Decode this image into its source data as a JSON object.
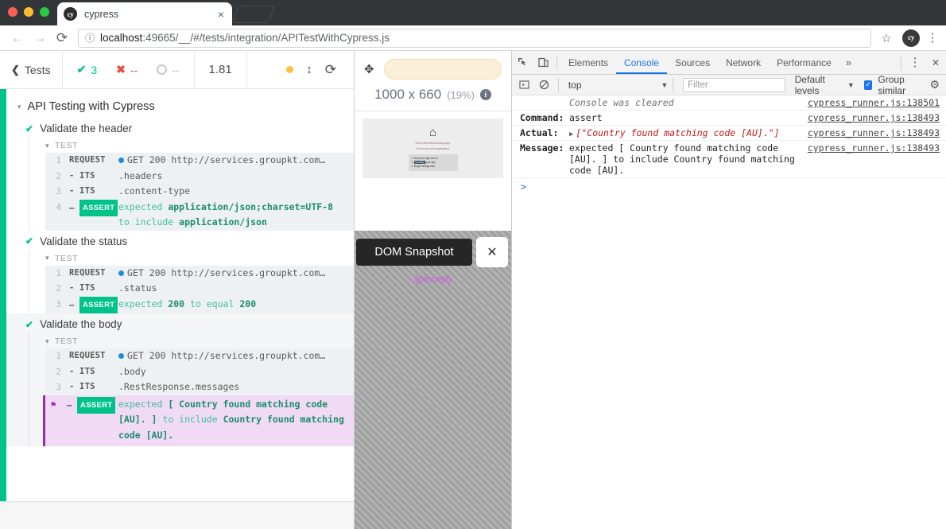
{
  "browser": {
    "tab": {
      "title": "cypress",
      "favicon_text": "cy",
      "close_icon": "×"
    },
    "nav": {
      "back": "←",
      "forward": "→",
      "reload": "⟳"
    },
    "omnibox": {
      "info_icon": "ⓘ",
      "host": "localhost",
      "rest": ":49665/__/#/tests/integration/APITestWithCypress.js",
      "full_url": "localhost:49665/__/#/tests/integration/APITestWithCypress.js"
    },
    "star_icon": "☆",
    "extension_text": "cy",
    "menu_icon": "⋮"
  },
  "reporter": {
    "header": {
      "back_label": "Tests",
      "back_chevron": "❮",
      "passed": {
        "icon": "✔",
        "value": "3"
      },
      "failed": {
        "icon": "✖",
        "value": "--"
      },
      "pending": {
        "value": "--"
      },
      "duration": "1.81",
      "reload_icon": "⟳",
      "updown_icon": "↕"
    },
    "suite": {
      "title": "API Testing with Cypress",
      "triangle": "▾"
    },
    "tests": [
      {
        "name": "Validate the header",
        "check": "✔",
        "group_label": "TEST",
        "commands": [
          {
            "num": "1",
            "name": "REQUEST",
            "message": "GET 200 http://services.groupkt.com…",
            "type": "request"
          },
          {
            "num": "2",
            "name": "- ITS",
            "message": ".headers",
            "type": "plain"
          },
          {
            "num": "3",
            "name": "- ITS",
            "message": ".content-type",
            "type": "plain"
          },
          {
            "num": "4",
            "name": "- ASSERT",
            "message": "expected application/json;charset=UTF-8 to include application/json",
            "type": "assert",
            "parts": [
              {
                "t": "expected ",
                "b": false
              },
              {
                "t": "application/json;charset=UTF-8",
                "b": true
              },
              {
                "t": " to include ",
                "b": false
              },
              {
                "t": "application/json",
                "b": true
              }
            ]
          }
        ]
      },
      {
        "name": "Validate the status",
        "check": "✔",
        "group_label": "TEST",
        "commands": [
          {
            "num": "1",
            "name": "REQUEST",
            "message": "GET 200 http://services.groupkt.com…",
            "type": "request"
          },
          {
            "num": "2",
            "name": "- ITS",
            "message": ".status",
            "type": "plain"
          },
          {
            "num": "3",
            "name": "- ASSERT",
            "message": "expected 200 to equal 200",
            "type": "assert",
            "parts": [
              {
                "t": "expected ",
                "b": false
              },
              {
                "t": "200",
                "b": true
              },
              {
                "t": " to equal ",
                "b": false
              },
              {
                "t": "200",
                "b": true
              }
            ]
          }
        ]
      },
      {
        "name": "Validate the body",
        "check": "✔",
        "group_label": "TEST",
        "commands": [
          {
            "num": "1",
            "name": "REQUEST",
            "message": "GET 200 http://services.groupkt.com…",
            "type": "request"
          },
          {
            "num": "2",
            "name": "- ITS",
            "message": ".body",
            "type": "plain"
          },
          {
            "num": "3",
            "name": "- ITS",
            "message": ".RestResponse.messages",
            "type": "plain"
          },
          {
            "num": "",
            "name": "- ASSERT",
            "pin_icon": "⚑",
            "type": "assert-pinned",
            "message": "expected [ Country found matching code [AU]. ] to include Country found matching code [AU].",
            "parts": [
              {
                "t": "expected ",
                "b": false
              },
              {
                "t": "[ Country found matching code [AU]. ]",
                "b": true
              },
              {
                "t": " to include ",
                "b": false
              },
              {
                "t": "Country found matching code [AU].",
                "b": true
              }
            ]
          }
        ]
      }
    ],
    "assert_badge": "ASSERT"
  },
  "preview": {
    "selector_playground_icon": "✥",
    "selector_value": "",
    "viewport_size": "1000 x 660",
    "scale": "(19%)",
    "info_icon": "i",
    "aut": {
      "home_icon": "⌂",
      "line1": "This is the default blank page.",
      "line2": "To test your web application:",
      "steps": [
        "1. Start your app server",
        "2. cy.visit() your app",
        "3. Begin writing tests"
      ],
      "highlight": "cy.visit()"
    },
    "snapshot": {
      "label": "DOM Snapshot",
      "close_icon": "✕",
      "pinned_label": "(pinned)"
    }
  },
  "devtools": {
    "inspect_icon": "inspect-element",
    "device_icon": "device-toolbar",
    "tabs": [
      "Elements",
      "Console",
      "Sources",
      "Network",
      "Performance"
    ],
    "selected_tab": "Console",
    "more_icon": "»",
    "menu_icon": "⋮",
    "close_icon": "✕",
    "console_toolbar": {
      "sidebar_icon": "▶",
      "clear_icon": "⊘",
      "context": "top",
      "context_caret": "▼",
      "filter_placeholder": "Filter",
      "levels": "Default levels",
      "levels_caret": "▼",
      "group_similar": "Group similar",
      "group_similar_checked": true,
      "checkbox_glyph": "✓",
      "settings_icon": "⚙"
    },
    "messages": [
      {
        "label": "",
        "text": "Console was cleared",
        "style": "dim",
        "source": "cypress_runner.js:138501"
      },
      {
        "label": "Command:",
        "text": "assert",
        "style": "normal",
        "source": "cypress_runner.js:138493"
      },
      {
        "label": "Actual:",
        "text": "[\"Country found matching code [AU].\"]",
        "style": "red-expandable",
        "arrow": "▶",
        "source": "cypress_runner.js:138493"
      },
      {
        "label": "Message:",
        "text": "expected [ Country found matching code [AU]. ] to include Country found matching code [AU].",
        "style": "normal",
        "source": "cypress_runner.js:138493"
      }
    ],
    "prompt": ">"
  },
  "colors": {
    "cypress_green": "#00c38a",
    "fail_red": "#e74c3c",
    "pinned_purple": "#9c27b0",
    "devtools_blue": "#1a73e8",
    "request_blue": "#1f8dd6"
  }
}
